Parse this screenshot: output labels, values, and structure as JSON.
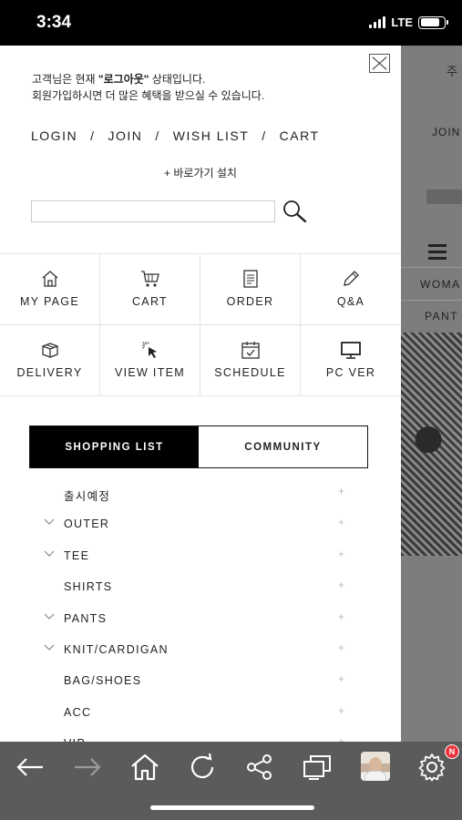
{
  "status_bar": {
    "time": "3:34",
    "network": "LTE",
    "battery_level": 0.8
  },
  "background_page": {
    "header_text": "주",
    "join_text": "JOIN",
    "nav_women": "WOMA",
    "nav_pants": "PANT"
  },
  "drawer": {
    "notice": {
      "line1_prefix": "고객님은 현재 ",
      "line1_status": "\"로그아웃\"",
      "line1_suffix": " 상태입니다.",
      "line2": "회원가입하시면 더 많은 혜택을 받으실 수 있습니다."
    },
    "top_links": {
      "login": "LOGIN",
      "join": "JOIN",
      "wishlist": "WISH LIST",
      "cart": "CART",
      "separator": "/"
    },
    "shortcut": "+ 바로가기 설치",
    "search": {
      "value": "",
      "placeholder": ""
    },
    "quick_menu": [
      {
        "label": "MY PAGE",
        "icon": "home-icon"
      },
      {
        "label": "CART",
        "icon": "cart-icon"
      },
      {
        "label": "ORDER",
        "icon": "order-icon"
      },
      {
        "label": "Q&A",
        "icon": "pencil-icon"
      },
      {
        "label": "DELIVERY",
        "icon": "box-icon"
      },
      {
        "label": "VIEW ITEM",
        "icon": "cursor-icon"
      },
      {
        "label": "SCHEDULE",
        "icon": "calendar-icon"
      },
      {
        "label": "PC VER",
        "icon": "monitor-icon"
      }
    ],
    "tabs": {
      "shopping": "SHOPPING LIST",
      "community": "COMMUNITY"
    },
    "categories": [
      {
        "label": "출시예정",
        "expandable": false
      },
      {
        "label": "OUTER",
        "expandable": true
      },
      {
        "label": "TEE",
        "expandable": true
      },
      {
        "label": "SHIRTS",
        "expandable": false
      },
      {
        "label": "PANTS",
        "expandable": true
      },
      {
        "label": "KNIT/CARDIGAN",
        "expandable": true
      },
      {
        "label": "BAG/SHOES",
        "expandable": false
      },
      {
        "label": "ACC",
        "expandable": false
      },
      {
        "label": "VIP",
        "expandable": false
      }
    ],
    "plus_symbol": "+"
  },
  "bottom_bar": {
    "icons": [
      "back-icon",
      "forward-icon",
      "home-icon",
      "refresh-icon",
      "share-icon",
      "tabs-icon",
      "avatar",
      "settings-icon"
    ],
    "settings_badge": "N"
  },
  "colors": {
    "accent": "#000000",
    "badge": "#e8343a",
    "bottom_bar": "#5b5b5b"
  }
}
